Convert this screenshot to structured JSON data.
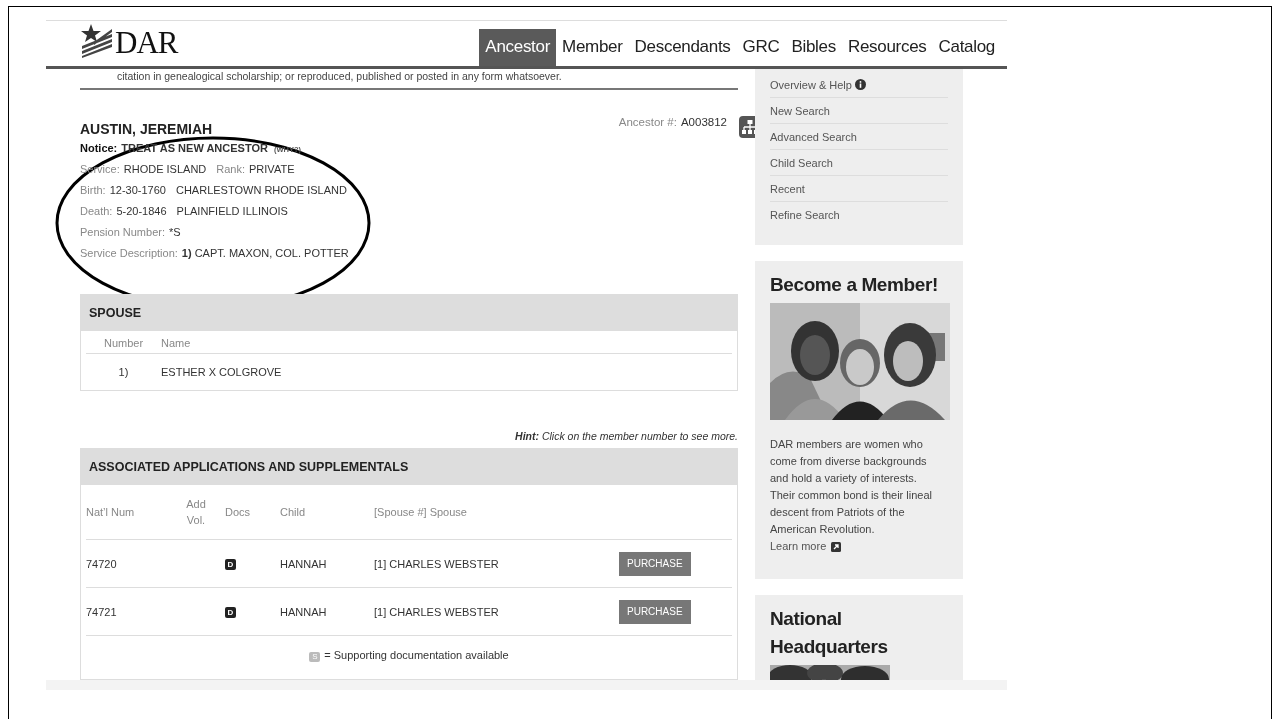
{
  "logo": {
    "text": "DAR"
  },
  "nav": [
    {
      "label": "Ancestor",
      "selected": true
    },
    {
      "label": "Member",
      "selected": false
    },
    {
      "label": "Descendants",
      "selected": false
    },
    {
      "label": "GRC",
      "selected": false
    },
    {
      "label": "Bibles",
      "selected": false
    },
    {
      "label": "Resources",
      "selected": false
    },
    {
      "label": "Catalog",
      "selected": false
    }
  ],
  "disclaimer": "citation in genealogical scholarship; or reproduced, published or posted in any form whatsoever.",
  "ancestor": {
    "name": "AUSTIN, JEREMIAH",
    "number_label": "Ancestor #:",
    "number": "A003812",
    "notice": {
      "label": "Notice:",
      "value": "TREAT AS NEW ANCESTOR",
      "link": "(WHY?)"
    },
    "facts": [
      [
        {
          "label": "Service:",
          "value": "RHODE ISLAND"
        },
        {
          "label": "Rank:",
          "value": "PRIVATE"
        }
      ],
      [
        {
          "label": "Birth:",
          "value": "12-30-1760"
        },
        {
          "value": "CHARLESTOWN RHODE ISLAND"
        }
      ],
      [
        {
          "label": "Death:",
          "value": "5-20-1846"
        },
        {
          "value": "PLAINFIELD ILLINOIS"
        }
      ],
      [
        {
          "label": "Pension Number:",
          "value": "*S"
        }
      ],
      [
        {
          "label": "Service Description:",
          "value": "**1)** CAPT. MAXON, COL. POTTER"
        }
      ]
    ]
  },
  "spouse": {
    "title": "SPOUSE",
    "columns": [
      "Number",
      "Name"
    ],
    "rows": [
      [
        "1)",
        "ESTHER X COLGROVE"
      ]
    ]
  },
  "hint": "**Hint:** Click on the member number to see more.",
  "applications": {
    "title": "ASSOCIATED APPLICATIONS AND SUPPLEMENTALS",
    "columns": [
      "Nat’l Num",
      "Add Vol.",
      "Docs",
      "Child",
      "[Spouse #] Spouse"
    ],
    "rows": [
      {
        "nat_num": "74720",
        "doc": "D",
        "child": "HANNAH",
        "spouse": "[1] CHARLES WEBSTER",
        "action": "PURCHASE"
      },
      {
        "nat_num": "74721",
        "doc": "D",
        "child": "HANNAH",
        "spouse": "[1] CHARLES WEBSTER",
        "action": "PURCHASE"
      }
    ],
    "legend": {
      "badge": "S",
      "text": "= Supporting documentation available"
    }
  },
  "sidebar": {
    "menu": [
      {
        "label": "Overview & Help",
        "info": true
      },
      {
        "label": "New Search"
      },
      {
        "label": "Advanced Search"
      },
      {
        "label": "Child Search"
      },
      {
        "label": "Recent"
      },
      {
        "label": "Refine Search"
      }
    ],
    "cards": [
      {
        "title": "Become a Member!",
        "text": "DAR members are women who come from diverse backgrounds and hold a variety of interests. Their common bond is their lineal descent from Patriots of the American Revolution.",
        "link": "Learn more"
      },
      {
        "title": "National Headquarters"
      }
    ]
  }
}
